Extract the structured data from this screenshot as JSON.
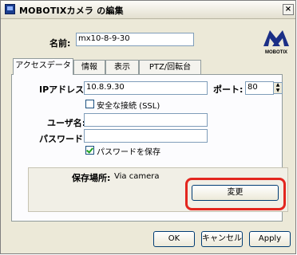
{
  "window": {
    "title": "MOBOTIXカメラ の編集",
    "close_glyph": "×"
  },
  "name_field": {
    "label": "名前:",
    "value": "mx10-8-9-30"
  },
  "logo": {
    "text": "MOBOTIX"
  },
  "tabs": [
    {
      "label": "アクセスデータ",
      "active": true
    },
    {
      "label": "情報",
      "active": false
    },
    {
      "label": "表示",
      "active": false
    },
    {
      "label": "PTZ/回転台",
      "active": false
    }
  ],
  "access": {
    "ip_label": "IPアドレス:",
    "ip_value": "10.8.9.30",
    "port_label": "ポート:",
    "port_value": "80",
    "ssl_label": "安全な接続 (SSL)",
    "ssl_checked": false,
    "user_label": "ユーザ名:",
    "user_value": "",
    "password_label": "パスワード:",
    "password_value": "",
    "save_password_label": "パスワードを保存",
    "save_password_checked": true
  },
  "storage": {
    "label": "保存場所:",
    "value": "Via camera",
    "change_button": "変更"
  },
  "footer": {
    "ok": "OK",
    "cancel": "キャンセル",
    "apply": "Apply"
  },
  "colors": {
    "highlight": "#e3261f",
    "logo_blue": "#1b2f86"
  }
}
